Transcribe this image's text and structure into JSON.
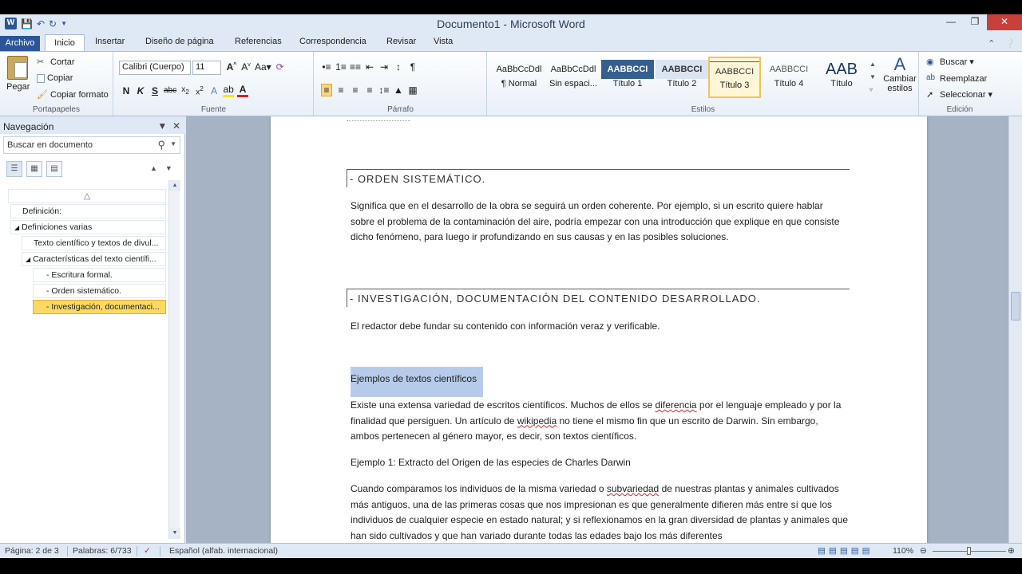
{
  "window": {
    "title": "Documento1 - Microsoft Word"
  },
  "tabs": [
    "Archivo",
    "Inicio",
    "Insertar",
    "Diseño de página",
    "Referencias",
    "Correspondencia",
    "Revisar",
    "Vista"
  ],
  "ribbon": {
    "clipboard": {
      "paste": "Pegar",
      "cut": "Cortar",
      "copy": "Copiar",
      "format_painter": "Copiar formato",
      "group": "Portapapeles"
    },
    "font": {
      "name": "Calibri (Cuerpo)",
      "size": "11",
      "group": "Fuente"
    },
    "paragraph": {
      "group": "Párrafo"
    },
    "styles": {
      "group": "Estilos",
      "items": [
        {
          "sample": "AaBbCcDdl",
          "name": "¶ Normal"
        },
        {
          "sample": "AaBbCcDdl",
          "name": "Sin espaci..."
        },
        {
          "sample": "AABBCCI",
          "name": "Título 1"
        },
        {
          "sample": "AABBCCI",
          "name": "Título 2"
        },
        {
          "sample": "AABBCCI",
          "name": "Título 3"
        },
        {
          "sample": "AABBCCI",
          "name": "Título 4"
        },
        {
          "sample": "AAB",
          "name": "Título"
        }
      ],
      "change_styles": "Cambiar estilos"
    },
    "editing": {
      "find": "Buscar",
      "replace": "Reemplazar",
      "select": "Seleccionar",
      "group": "Edición"
    }
  },
  "nav": {
    "title": "Navegación",
    "search_placeholder": "Buscar en documento",
    "items": [
      {
        "label": "Definición:"
      },
      {
        "label": "Definiciones varias"
      },
      {
        "label": "Texto científico y textos de divul..."
      },
      {
        "label": "Características del texto científi..."
      },
      {
        "label": "- Escritura formal."
      },
      {
        "label": "- Orden sistemático."
      },
      {
        "label": "- Investigación, documentaci..."
      }
    ]
  },
  "document": {
    "heading1": "- ORDEN SISTEMÁTICO.",
    "para1": "Significa que en el desarrollo de la obra se seguirá un orden coherente. Por ejemplo, si un escrito quiere hablar sobre el problema de la contaminación del aire, podría empezar con una introducción que explique en que consiste dicho fenómeno, para luego ir profundizando en sus causas y en las posibles soluciones.",
    "heading2": "- INVESTIGACIÓN,  DOCUMENTACIÓN DEL CONTENIDO DESARROLLADO.",
    "para2": "El redactor debe fundar su contenido con información veraz y verificable.",
    "selected_heading": "Ejemplos de textos científicos",
    "para3_a": "Existe una extensa variedad de escritos científicos. Muchos de ellos se ",
    "para3_b": "diferencia",
    "para3_c": " por el lenguaje empleado y por la finalidad que persiguen. Un artículo de ",
    "para3_d": "wikipedia",
    "para3_e": " no tiene el mismo fin que un escrito de Darwin. Sin embargo, ambos pertenecen al género mayor, es decir, son textos científicos.",
    "example1": "Ejemplo 1: Extracto del Origen de las especies de Charles Darwin",
    "para4_a": "Cuando comparamos los individuos de la misma variedad o ",
    "para4_b": "subvariedad",
    "para4_c": " de nuestras plantas y animales cultivados más antiguos, una de las primeras cosas que nos impresionan es que generalmente difieren más entre sí que los individuos de cualquier especie en estado natural; y si reflexionamos en la gran diversidad de plantas y animales que han sido cultivados y que han variado durante todas las edades bajo los más diferentes"
  },
  "status": {
    "page": "Página: 2 de 3",
    "words": "Palabras: 6/733",
    "language": "Español (alfab. internacional)",
    "zoom": "110%"
  }
}
